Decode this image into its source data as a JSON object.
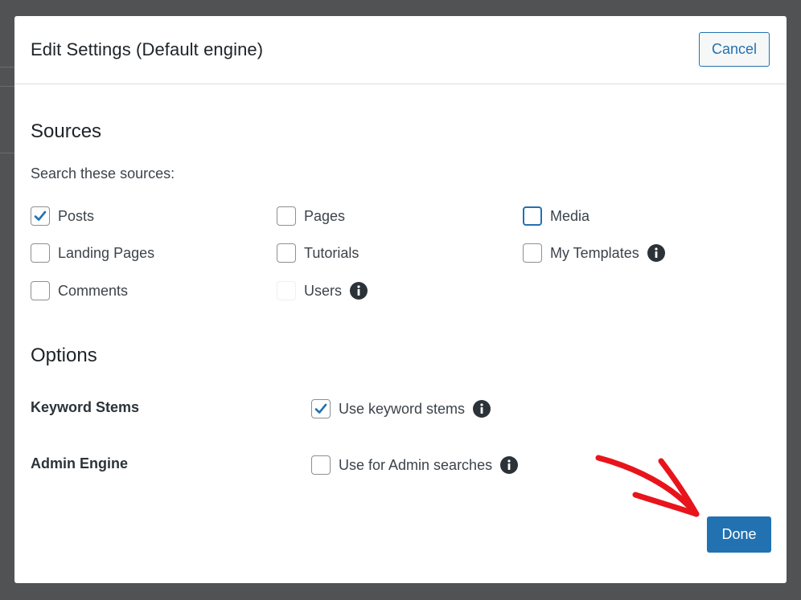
{
  "modal": {
    "title": "Edit Settings (Default engine)",
    "cancel_label": "Cancel",
    "done_label": "Done"
  },
  "sources": {
    "heading": "Sources",
    "subtext": "Search these sources:",
    "items": [
      {
        "label": "Posts",
        "checked": true
      },
      {
        "label": "Pages",
        "checked": false
      },
      {
        "label": "Media",
        "checked": false,
        "focused": true
      },
      {
        "label": "Landing Pages",
        "checked": false
      },
      {
        "label": "Tutorials",
        "checked": false
      },
      {
        "label": "My Templates",
        "checked": false,
        "info": true
      },
      {
        "label": "Comments",
        "checked": false
      },
      {
        "label": "Users",
        "checked": false,
        "info": true,
        "disabled": true
      }
    ]
  },
  "options": {
    "heading": "Options",
    "keyword_stems": {
      "label": "Keyword Stems",
      "checkbox_label": "Use keyword stems",
      "checked": true
    },
    "admin_engine": {
      "label": "Admin Engine",
      "checkbox_label": "Use for Admin searches",
      "checked": false
    }
  },
  "colors": {
    "accent": "#2271b1",
    "annotation_arrow": "#e8141c",
    "backdrop": "#505253"
  },
  "icons": {
    "check": "checkmark-icon",
    "info": "info-circle-icon",
    "annotation": "red-arrow-icon"
  }
}
